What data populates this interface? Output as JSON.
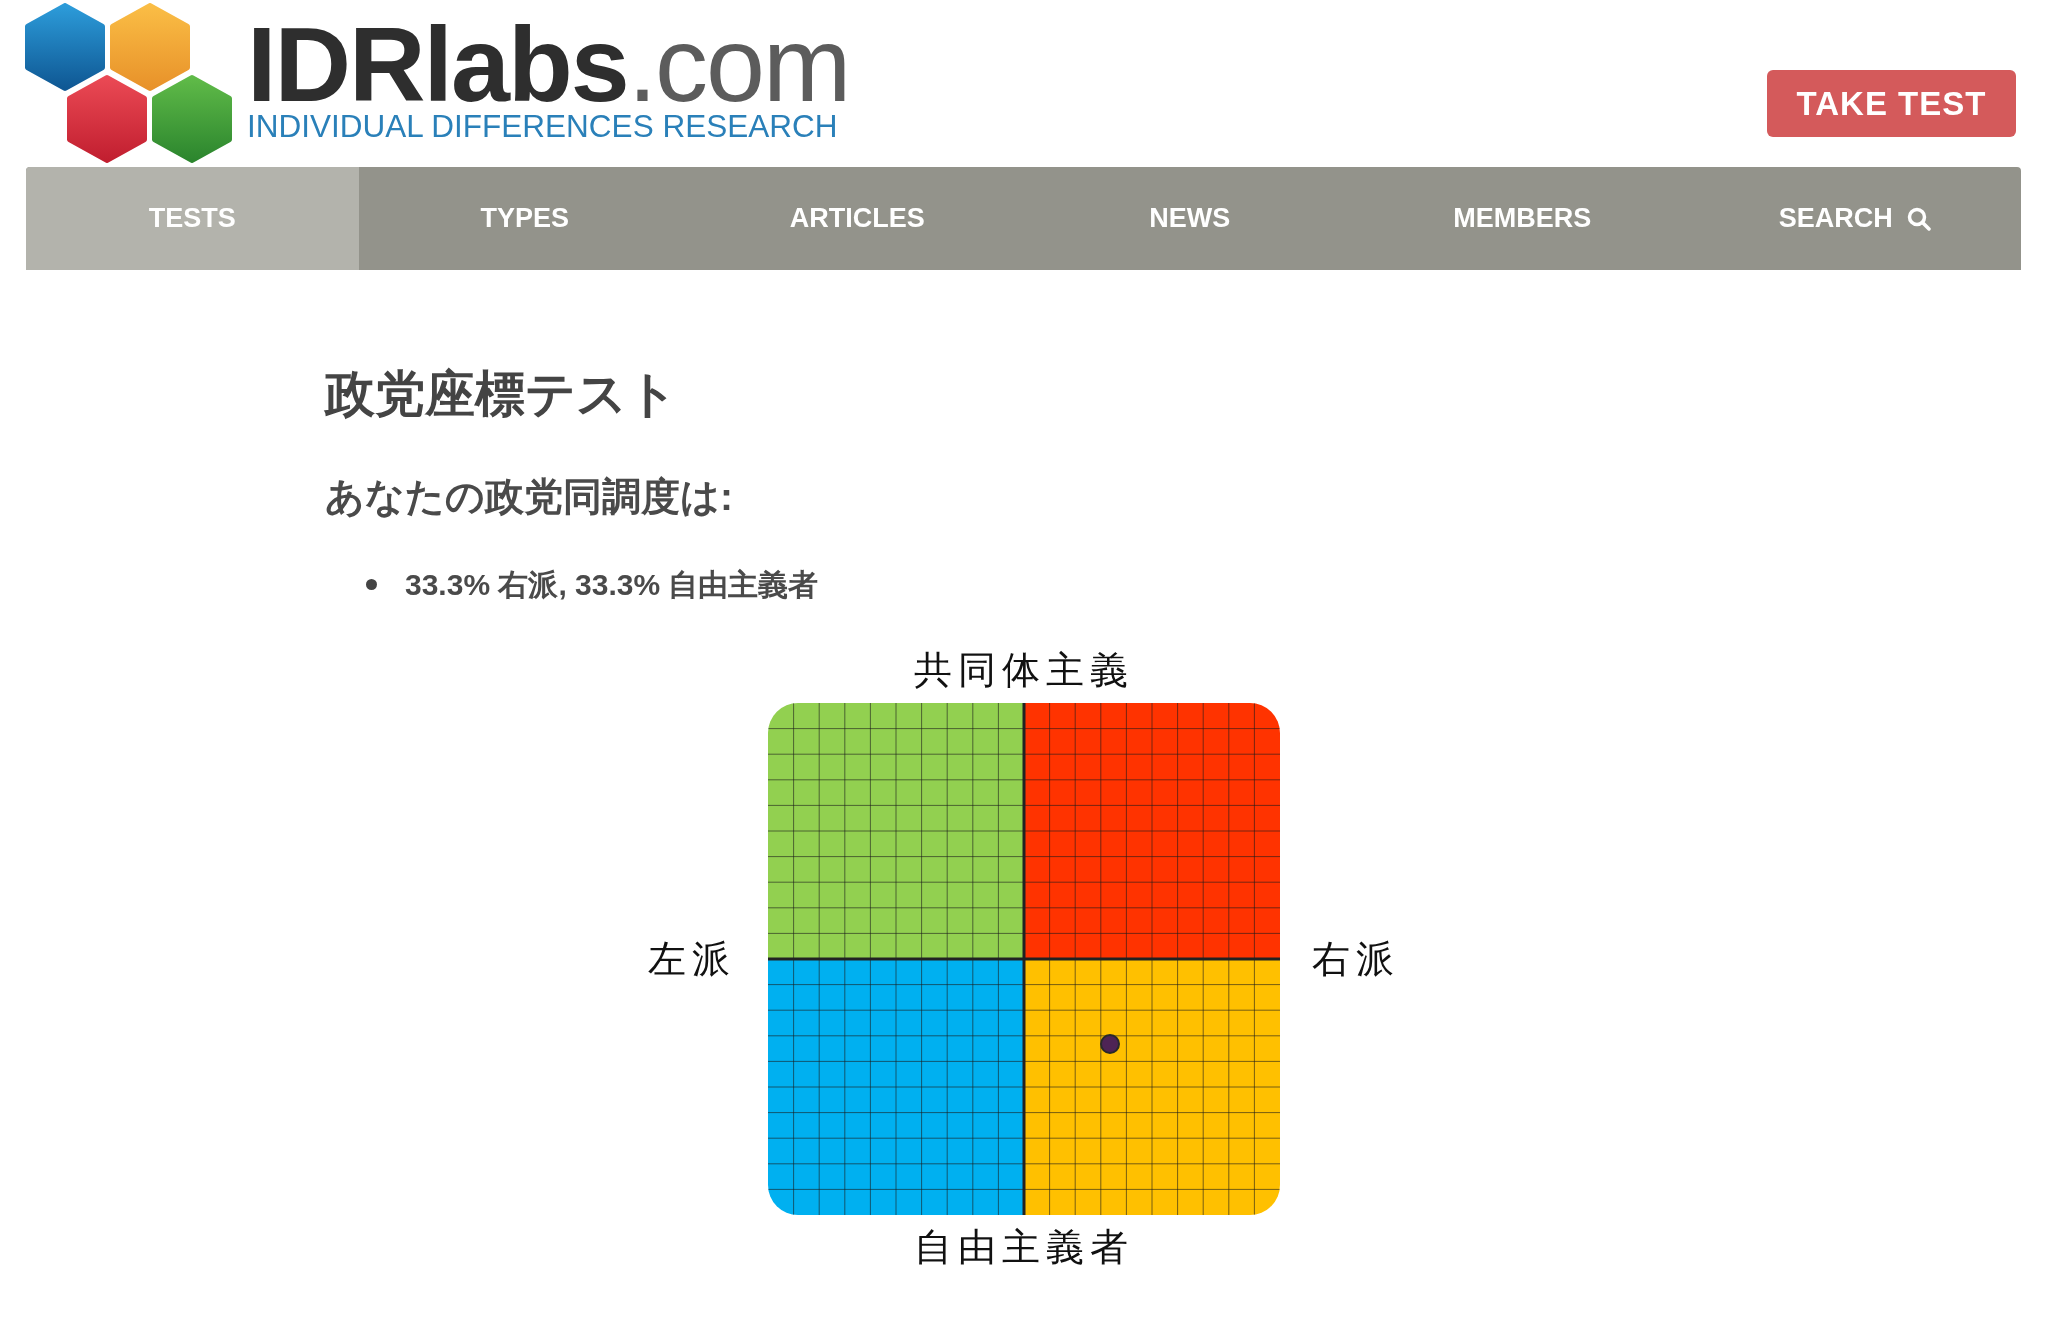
{
  "header": {
    "logo_text": "**IDRlabs**.com",
    "tagline": "INDIVIDUAL DIFFERENCES RESEARCH",
    "cta_button": "TAKE TEST"
  },
  "nav": {
    "items": [
      {
        "label": "TESTS",
        "kind": "link",
        "selected": true
      },
      {
        "label": "TYPES",
        "kind": "link",
        "selected": false
      },
      {
        "label": "ARTICLES",
        "kind": "link",
        "selected": false
      },
      {
        "label": "NEWS",
        "kind": "link",
        "selected": false
      },
      {
        "label": "MEMBERS",
        "kind": "link",
        "selected": false
      },
      {
        "label": "SEARCH",
        "kind": "search",
        "selected": false
      }
    ]
  },
  "page": {
    "title": "政党座標テスト",
    "subtitle": "あなたの政党同調度は:",
    "results": [
      "33.3% 右派, 33.3% 自由主義者"
    ]
  },
  "compass": {
    "top_label": "共同体主義",
    "bottom_label": "自由主義者",
    "left_label": "左派",
    "right_label": "右派"
  }
}
